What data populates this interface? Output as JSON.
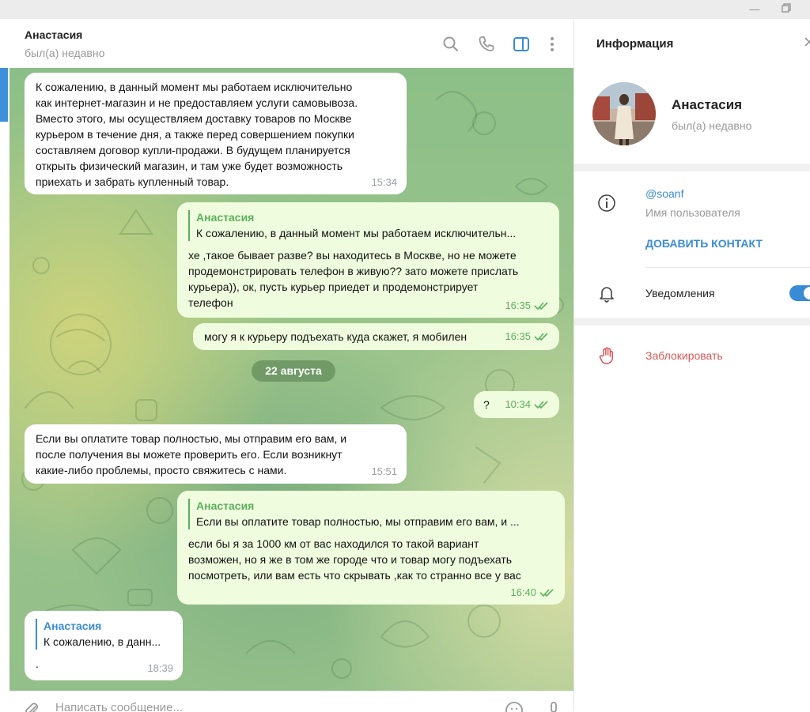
{
  "chat": {
    "name": "Анастасия",
    "status": "был(а) недавно",
    "date_separator": "22 августа",
    "composer_placeholder": "Написать сообщение...",
    "messages": [
      {
        "text": "К сожалению, в данный момент мы работаем исключительно\nкак интернет-магазин и не предоставляем услуги самовывоза.\nВместо этого, мы осуществляем доставку товаров по Москве\nкурьером в течение дня, а также перед совершением покупки\nсоставляем договор купли-продажи. В будущем планируется\nоткрыть физический магазин, и там уже будет возможность\nприехать и забрать купленный товар.",
        "time": "15:34"
      },
      {
        "reply_name": "Анастасия",
        "reply_text": "К сожалению, в данный момент мы работаем исключительн...",
        "text": "хе ,такое бывает разве? вы находитесь в Москве, но не можете\nпродемонстрировать телефон в живую?? зато можете прислать\nкурьера)), ок, пусть курьер приедет и продемонстрирует\nтелефон",
        "time": "16:35"
      },
      {
        "text": "могу я к курьеру подъехать куда скажет, я мобилен",
        "time": "16:35"
      },
      {
        "text": "?",
        "time": "10:34"
      },
      {
        "text": "Если вы оплатите товар полностью, мы отправим его вам, и\nпосле получения вы можете проверить его. Если возникнут\nкакие-либо проблемы, просто свяжитесь с нами.",
        "time": "15:51"
      },
      {
        "reply_name": "Анастасия",
        "reply_text": "Если вы оплатите товар полностью, мы отправим его вам, и ...",
        "text": "если бы я за 1000 км от вас находился то такой вариант\nвозможен, но я же в том же городе что и товар могу подъехать\nпосмотреть, или вам есть что скрывать ,как то странно все у вас",
        "time": "16:40"
      },
      {
        "reply_name": "Анастасия",
        "reply_text": "К сожалению, в данн...",
        "text": ".",
        "time": "18:39"
      }
    ]
  },
  "info_panel": {
    "title": "Информация",
    "name": "Анастасия",
    "status": "был(а) недавно",
    "username": "@soanf",
    "username_label": "Имя пользователя",
    "add_contact": "ДОБАВИТЬ КОНТАКТ",
    "notifications_label": "Уведомления",
    "notifications_on": true,
    "block_label": "Заблокировать"
  },
  "icons": [
    "search-icon",
    "phone-icon",
    "sidebar-toggle-icon",
    "more-vertical-icon",
    "close-icon",
    "info-icon",
    "bell-icon",
    "block-hand-icon",
    "attach-icon",
    "emoji-icon",
    "microphone-icon",
    "minimize-icon",
    "restore-icon"
  ],
  "colors": {
    "accent": "#3a8bd6",
    "outgoing_bubble": "#effdde",
    "outgoing_meta": "#5daf5e",
    "danger": "#d95757"
  }
}
